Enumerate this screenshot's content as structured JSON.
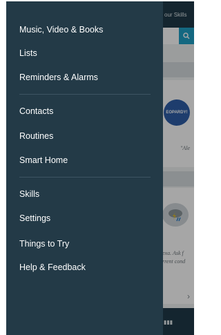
{
  "background_app": {
    "tab_label": "our Skills",
    "search_icon": "search-icon",
    "card1_logo_text": "EOPARDY!",
    "card1_quote": "\"Ale",
    "card2_icon": "storm-cloud-icon",
    "card2_quote_line1": "exa. Ask f",
    "card2_quote_line2": "rrent cond",
    "chevron_icon": "chevron-right-icon",
    "bottom_icon": "equalizer-icon"
  },
  "drawer": {
    "items": [
      {
        "label": "Music, Video & Books"
      },
      {
        "label": "Lists"
      },
      {
        "label": "Reminders & Alarms"
      },
      {
        "label": "Contacts"
      },
      {
        "label": "Routines"
      },
      {
        "label": "Smart Home"
      },
      {
        "label": "Skills"
      },
      {
        "label": "Settings"
      },
      {
        "label": "Things to Try"
      },
      {
        "label": "Help & Feedback"
      }
    ]
  },
  "colors": {
    "drawer_bg": "#233a47",
    "accent": "#1fa0c6"
  }
}
